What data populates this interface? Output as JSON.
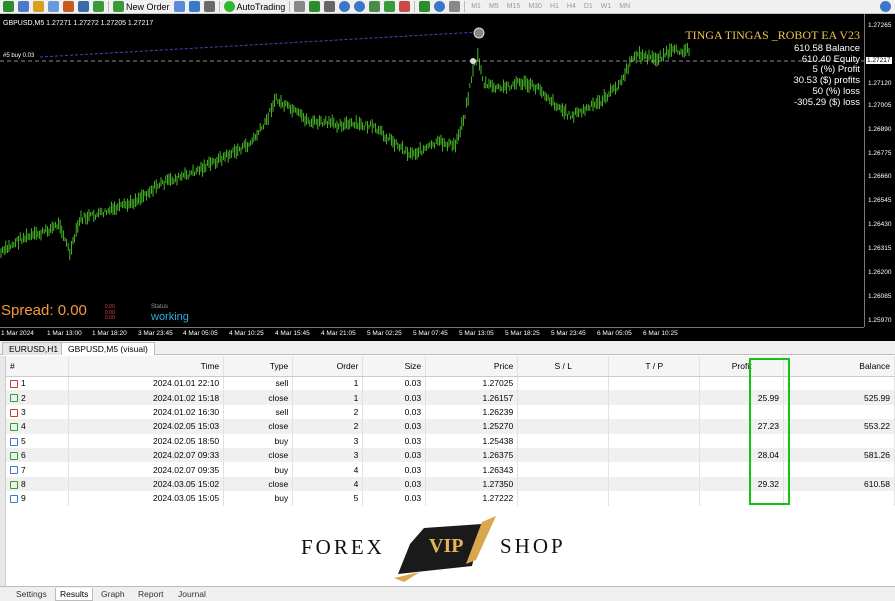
{
  "toolbar": {
    "new_order_label": "New Order",
    "autotrading_label": "AutoTrading",
    "timeframes": [
      "M1",
      "M5",
      "M15",
      "M30",
      "H1",
      "H4",
      "D1",
      "W1",
      "MN"
    ]
  },
  "chart": {
    "symbol_line": "GBPUSD,M5  1.27271 1.27272 1.27205 1.27217",
    "trade_label": "#5 buy 0.03",
    "ea_title": "TINGA TINGAS _ROBOT EA V23",
    "ea_lines": [
      "610.58 Balance",
      "610.40 Equity",
      "5 (%) Profit",
      "30.53 ($) profits",
      "50 (%) loss",
      "-305.29 ($) loss"
    ],
    "price_labels": [
      "1.27265",
      "1.27217",
      "1.27120",
      "1.27005",
      "1.26890",
      "1.26775",
      "1.26660",
      "1.26545",
      "1.26430",
      "1.26315",
      "1.26200",
      "1.26085",
      "1.25970"
    ],
    "current_price": "1.27217",
    "time_labels": [
      "1 Mar 2024",
      "1 Mar 13:00",
      "1 Mar 18:20",
      "3 Mar 23:45",
      "4 Mar 05:05",
      "4 Mar 10:25",
      "4 Mar 15:45",
      "4 Mar 21:05",
      "5 Mar 02:25",
      "5 Mar 07:45",
      "5 Mar 13:05",
      "5 Mar 18:25",
      "5 Mar 23:45",
      "6 Mar 05:05",
      "6 Mar 10:25"
    ],
    "spread_label": "Spread: 0.00",
    "mini_labels": [
      "0.00",
      "0.00",
      "0.00"
    ],
    "status_label": "Status",
    "status_value": "working",
    "bullish_color": "#4ec82a",
    "background_color": "#000000"
  },
  "chart_tabs": [
    "EURUSD,H1",
    "GBPUSD,M5 (visual)"
  ],
  "table": {
    "headers": [
      "#",
      "Time",
      "Type",
      "Order",
      "Size",
      "Price",
      "S / L",
      "T / P",
      "Profit",
      "Balance"
    ],
    "rows": [
      {
        "n": "1",
        "time": "2024.01.01 22:10",
        "type": "sell",
        "order": "1",
        "size": "0.03",
        "price": "1.27025",
        "sl": "",
        "tp": "",
        "profit": "",
        "balance": ""
      },
      {
        "n": "2",
        "time": "2024.01.02 15:18",
        "type": "close",
        "order": "1",
        "size": "0.03",
        "price": "1.26157",
        "sl": "",
        "tp": "",
        "profit": "25.99",
        "balance": "525.99"
      },
      {
        "n": "3",
        "time": "2024.01.02 16:30",
        "type": "sell",
        "order": "2",
        "size": "0.03",
        "price": "1.26239",
        "sl": "",
        "tp": "",
        "profit": "",
        "balance": ""
      },
      {
        "n": "4",
        "time": "2024.02.05 15:03",
        "type": "close",
        "order": "2",
        "size": "0.03",
        "price": "1.25270",
        "sl": "",
        "tp": "",
        "profit": "27.23",
        "balance": "553.22"
      },
      {
        "n": "5",
        "time": "2024.02.05 18:50",
        "type": "buy",
        "order": "3",
        "size": "0.03",
        "price": "1.25438",
        "sl": "",
        "tp": "",
        "profit": "",
        "balance": ""
      },
      {
        "n": "6",
        "time": "2024.02.07 09:33",
        "type": "close",
        "order": "3",
        "size": "0.03",
        "price": "1.26375",
        "sl": "",
        "tp": "",
        "profit": "28.04",
        "balance": "581.26"
      },
      {
        "n": "7",
        "time": "2024.02.07 09:35",
        "type": "buy",
        "order": "4",
        "size": "0.03",
        "price": "1.26343",
        "sl": "",
        "tp": "",
        "profit": "",
        "balance": ""
      },
      {
        "n": "8",
        "time": "2024.03.05 15:02",
        "type": "close",
        "order": "4",
        "size": "0.03",
        "price": "1.27350",
        "sl": "",
        "tp": "",
        "profit": "29.32",
        "balance": "610.58"
      },
      {
        "n": "9",
        "time": "2024.03.05 15:05",
        "type": "buy",
        "order": "5",
        "size": "0.03",
        "price": "1.27222",
        "sl": "",
        "tp": "",
        "profit": "",
        "balance": ""
      }
    ]
  },
  "logo": {
    "left": "FOREX",
    "middle": "VIP",
    "right": "SHOP"
  },
  "bottom_tabs": [
    "Settings",
    "Results",
    "Graph",
    "Report",
    "Journal"
  ],
  "active_bottom_tab": "Results",
  "highlight_color": "#13c313"
}
